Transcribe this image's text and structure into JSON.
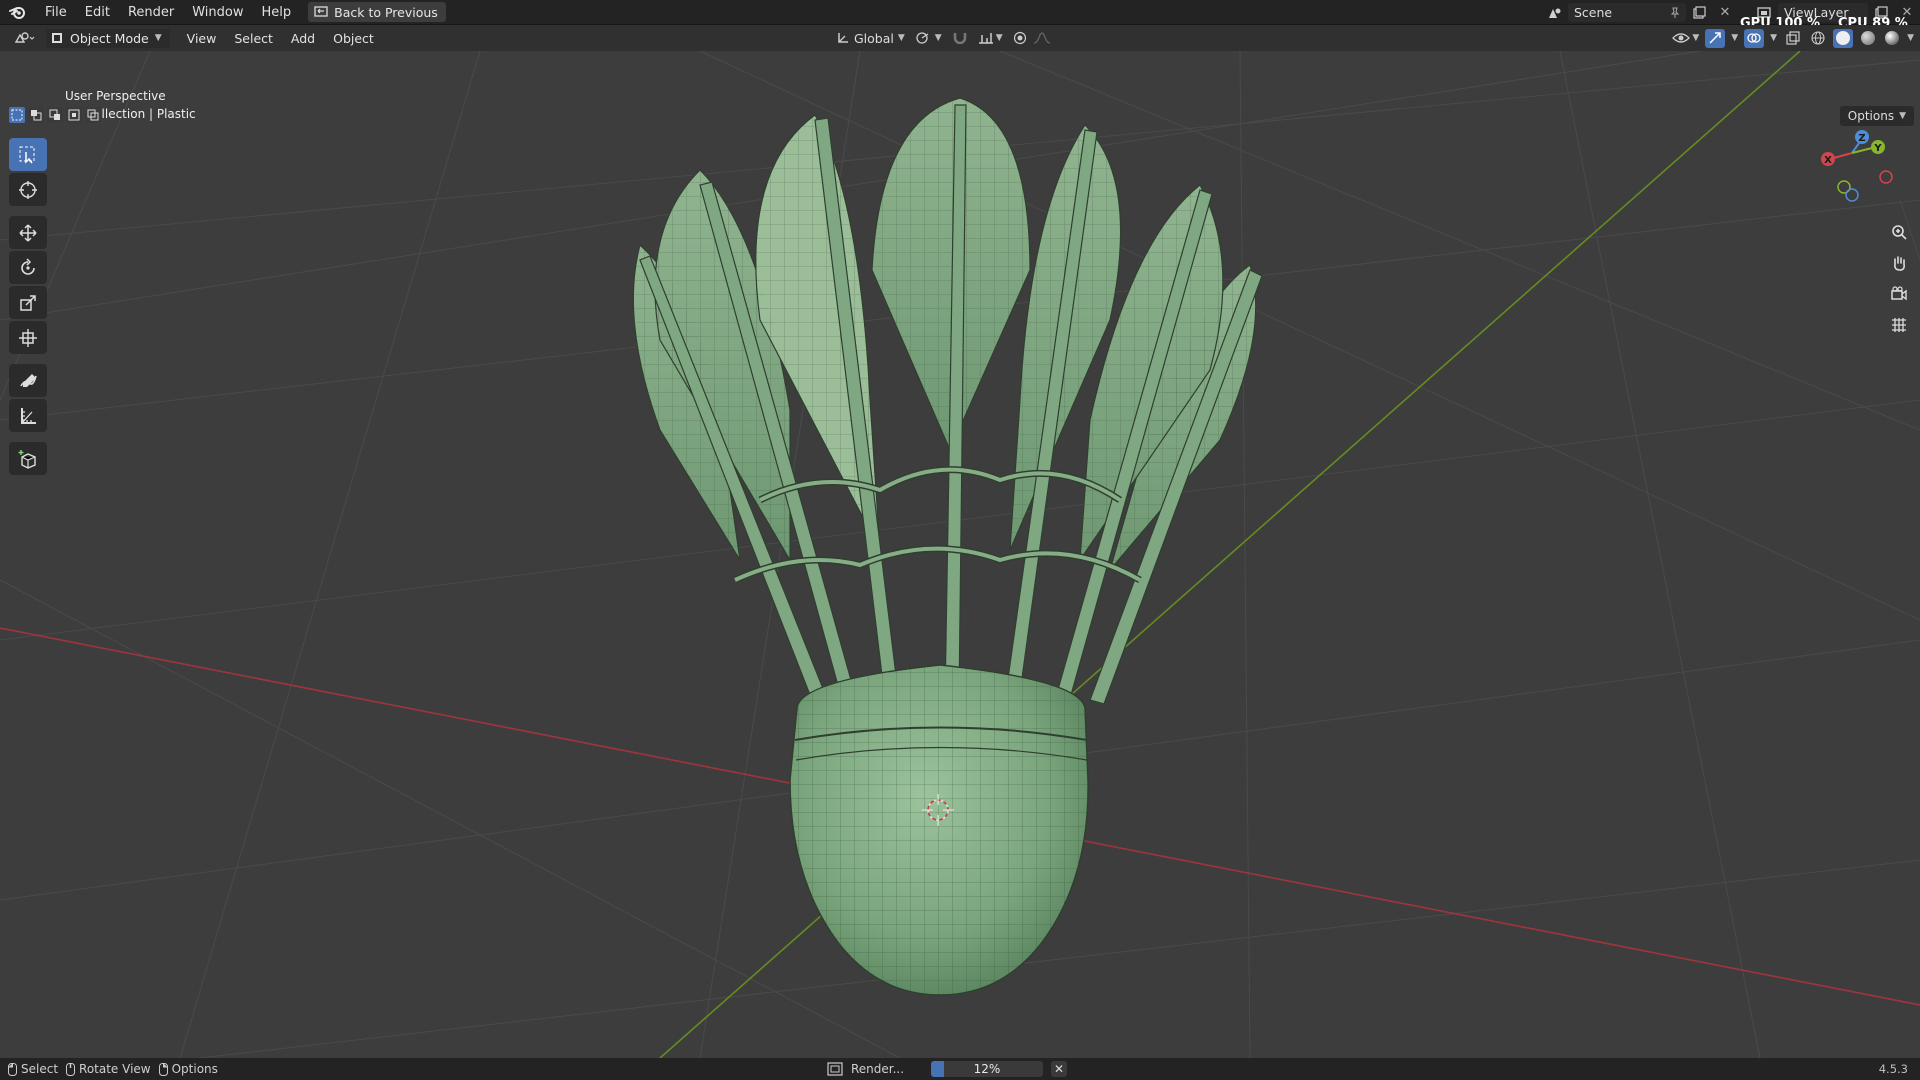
{
  "menu": {
    "items": [
      "File",
      "Edit",
      "Render",
      "Window",
      "Help"
    ],
    "back_button": "Back to Previous"
  },
  "topbar_right": {
    "scene": "Scene",
    "view_layer": "ViewLayer",
    "gpu_label": "GPU",
    "gpu_value": "100 %",
    "cpu_label": "CPU",
    "cpu_value": "89 %"
  },
  "header": {
    "mode": "Object Mode",
    "menus": [
      "View",
      "Select",
      "Add",
      "Object"
    ],
    "transform_orientation": "Global"
  },
  "viewport": {
    "perspective": "User Perspective",
    "collection": "(1) Collection | Plastic",
    "options": "Options"
  },
  "gizmo": {
    "x": "X",
    "y": "Y",
    "z": "Z"
  },
  "statusbar": {
    "select": "Select",
    "rotate": "Rotate View",
    "options": "Options",
    "render_label": "Render...",
    "progress_percent": 12,
    "progress_text": "12%",
    "version": "4.5.3"
  },
  "colors": {
    "accent": "#4772b3",
    "mesh_fill": "#86ad86",
    "mesh_dark": "#5e8a62",
    "wire": "#2f3f2f",
    "x_axis": "#b0343c",
    "y_axis": "#6b9a1c"
  }
}
